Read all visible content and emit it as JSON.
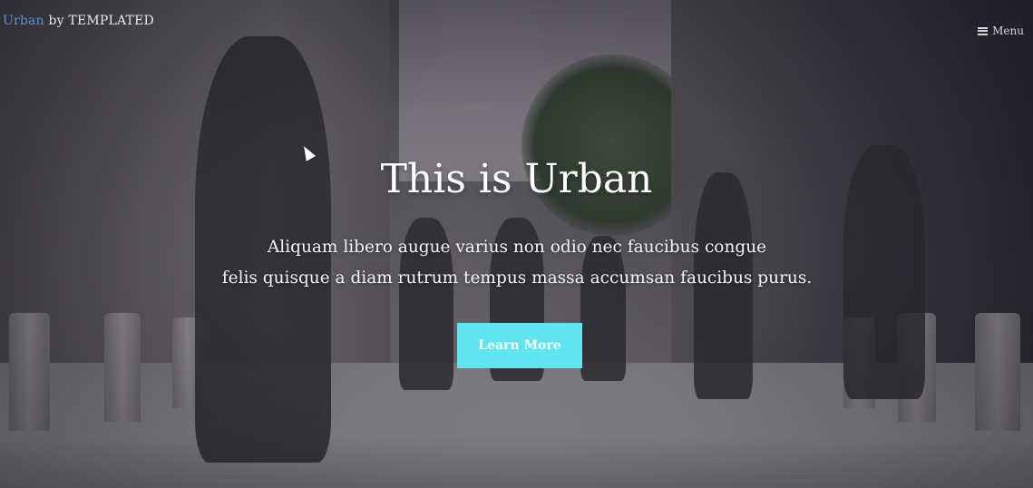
{
  "header": {
    "logo_brand": "Urban",
    "logo_suffix": "by TEMPLATED",
    "menu_label": "Menu",
    "menu_icon": "hamburger-icon"
  },
  "hero": {
    "title": "This is Urban",
    "subtitle_line1": "Aliquam libero augue varius non odio nec faucibus congue",
    "subtitle_line2": "felis quisque a diam rutrum tempus massa accumsan faucibus purus.",
    "cta_label": "Learn More"
  },
  "colors": {
    "brand": "#5b8fd8",
    "cta": "#5ee6f0",
    "text": "#ffffff"
  }
}
